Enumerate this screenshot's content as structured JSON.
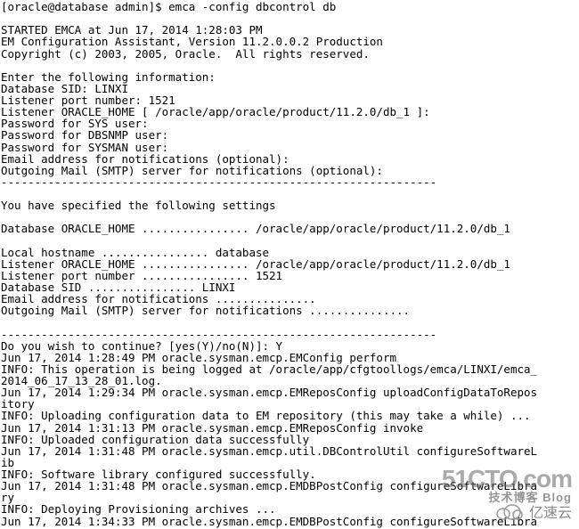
{
  "lines": [
    "[oracle@database admin]$ emca -config dbcontrol db",
    "",
    "STARTED EMCA at Jun 17, 2014 1:28:03 PM",
    "EM Configuration Assistant, Version 11.2.0.0.2 Production",
    "Copyright (c) 2003, 2005, Oracle.  All rights reserved.",
    "",
    "Enter the following information:",
    "Database SID: LINXI",
    "Listener port number: 1521",
    "Listener ORACLE_HOME [ /oracle/app/oracle/product/11.2.0/db_1 ]:",
    "Password for SYS user:",
    "Password for DBSNMP user:",
    "Password for SYSMAN user:",
    "Email address for notifications (optional):",
    "Outgoing Mail (SMTP) server for notifications (optional):",
    "-----------------------------------------------------------------",
    "",
    "You have specified the following settings",
    "",
    "Database ORACLE_HOME ................ /oracle/app/oracle/product/11.2.0/db_1",
    "",
    "Local hostname ................ database",
    "Listener ORACLE_HOME ................ /oracle/app/oracle/product/11.2.0/db_1",
    "Listener port number ................ 1521",
    "Database SID ................ LINXI",
    "Email address for notifications ...............",
    "Outgoing Mail (SMTP) server for notifications ...............",
    "",
    "-----------------------------------------------------------------",
    "Do you wish to continue? [yes(Y)/no(N)]: Y",
    "Jun 17, 2014 1:28:49 PM oracle.sysman.emcp.EMConfig perform",
    "INFO: This operation is being logged at /oracle/app/cfgtoollogs/emca/LINXI/emca_",
    "2014_06_17_13_28_01.log.",
    "Jun 17, 2014 1:29:34 PM oracle.sysman.emcp.EMReposConfig uploadConfigDataToRepos",
    "itory",
    "INFO: Uploading configuration data to EM repository (this may take a while) ...",
    "Jun 17, 2014 1:31:13 PM oracle.sysman.emcp.EMReposConfig invoke",
    "INFO: Uploaded configuration data successfully",
    "Jun 17, 2014 1:31:48 PM oracle.sysman.emcp.util.DBControlUtil configureSoftwareL",
    "ib",
    "INFO: Software library configured successfully.",
    "Jun 17, 2014 1:31:48 PM oracle.sysman.emcp.EMDBPostConfig configureSoftwareLibra",
    "ry",
    "INFO: Deploying Provisioning archives ...",
    "Jun 17, 2014 1:34:33 PM oracle.sysman.emcp.EMDBPostConfig configureSoftwareLibra"
  ],
  "watermark1": {
    "main": "51CTO.com",
    "sub": "技术博客 Blog"
  },
  "watermark2": "亿速云"
}
